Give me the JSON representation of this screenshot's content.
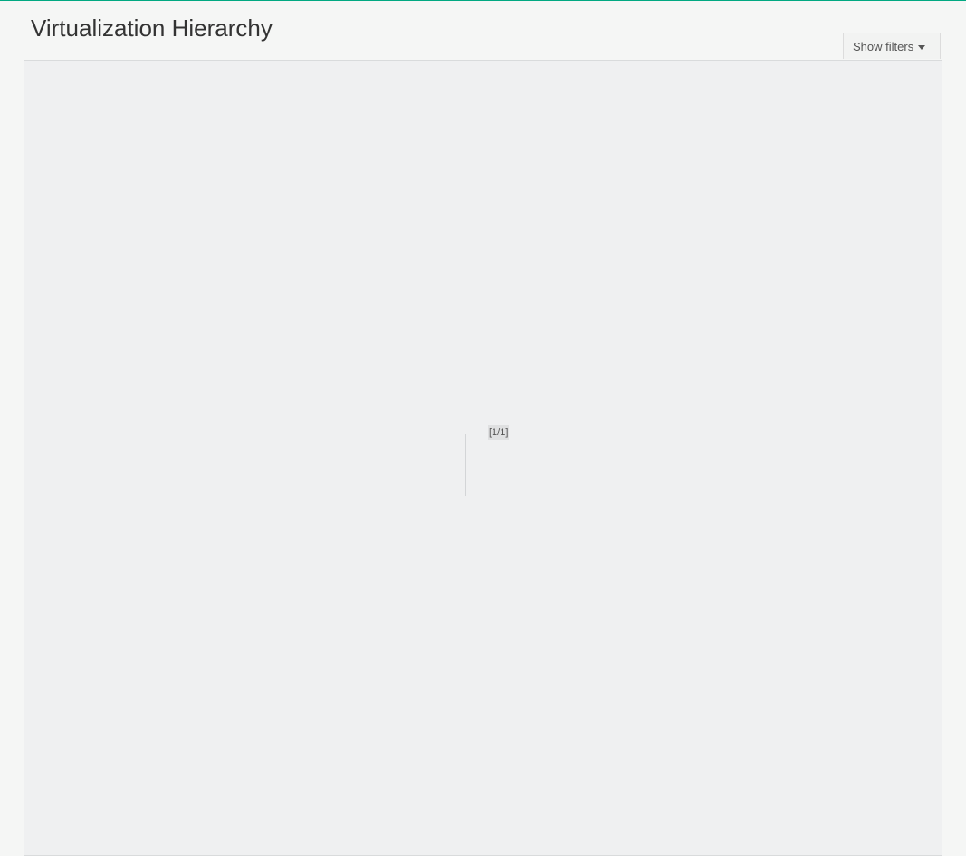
{
  "header": {
    "title": "Virtualization Hierarchy"
  },
  "toolbar": {
    "filters_label": "Show filters",
    "filters_icon": "caret-down-icon"
  },
  "canvas": {
    "page_indicator": "[1/1]"
  },
  "colors": {
    "accent": "#01a982",
    "page_background": "#f5f6f5",
    "canvas_background": "#eff0f1"
  }
}
